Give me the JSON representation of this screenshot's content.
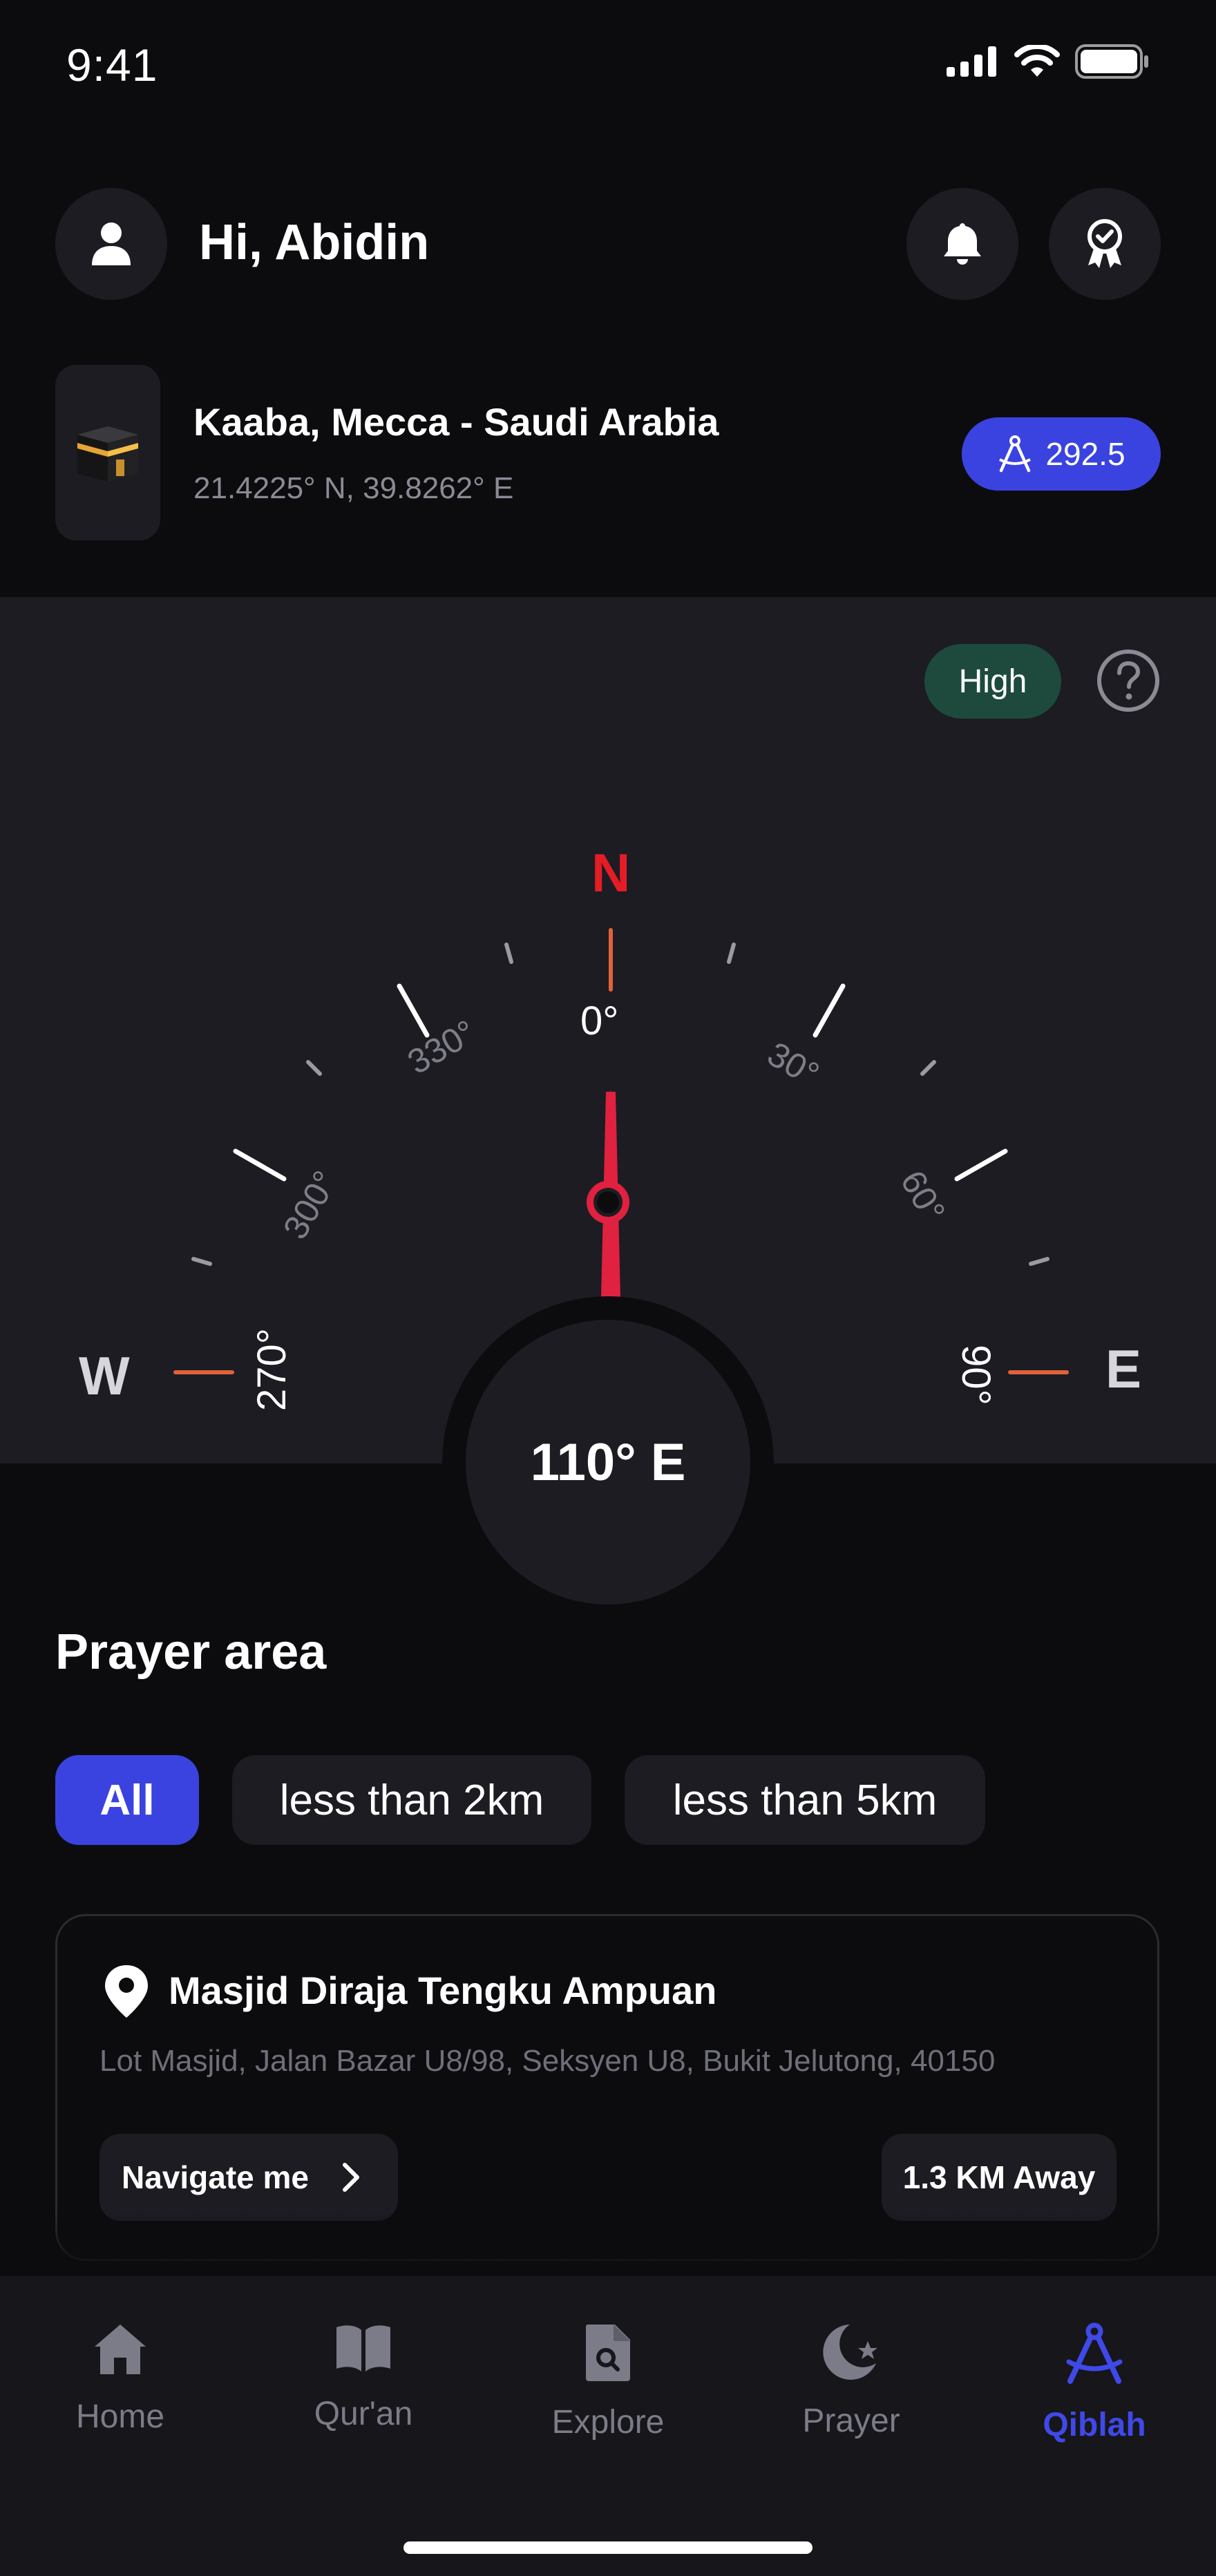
{
  "status_bar": {
    "time": "9:41"
  },
  "header": {
    "greeting": "Hi, Abidin"
  },
  "location": {
    "title": "Kaaba, Mecca - Saudi Arabia",
    "coords": "21.4225° N, 39.8262° E",
    "qibla_value": "292.5"
  },
  "compass": {
    "accuracy": "High",
    "north": "N",
    "west": "W",
    "east": "E",
    "ticks": {
      "t0": "0°",
      "t30": "30°",
      "t60": "60°",
      "t90": "90°",
      "t270": "270°",
      "t300": "300°",
      "t330": "330°"
    },
    "heading": "110° E"
  },
  "prayer_area": {
    "title": "Prayer area",
    "filters": [
      "All",
      "less than 2km",
      "less than 5km"
    ],
    "mosque": {
      "name": "Masjid Diraja Tengku Ampuan",
      "address": "Lot Masjid, Jalan Bazar U8/98, Seksyen U8, Bukit Jelutong, 40150",
      "navigate_label": "Navigate me",
      "distance": "1.3 KM Away"
    }
  },
  "tabs": [
    {
      "label": "Home",
      "icon": "home-icon"
    },
    {
      "label": "Qur'an",
      "icon": "book-icon"
    },
    {
      "label": "Explore",
      "icon": "explore-icon"
    },
    {
      "label": "Prayer",
      "icon": "crescent-star-icon"
    },
    {
      "label": "Qiblah",
      "icon": "qibla-compass-icon"
    }
  ],
  "colors": {
    "accent": "#3a43e0",
    "accuracy_bg": "#1d4a3d",
    "north": "#e31c25",
    "needle": "#e0213f",
    "tick_accent": "#e0623a"
  }
}
